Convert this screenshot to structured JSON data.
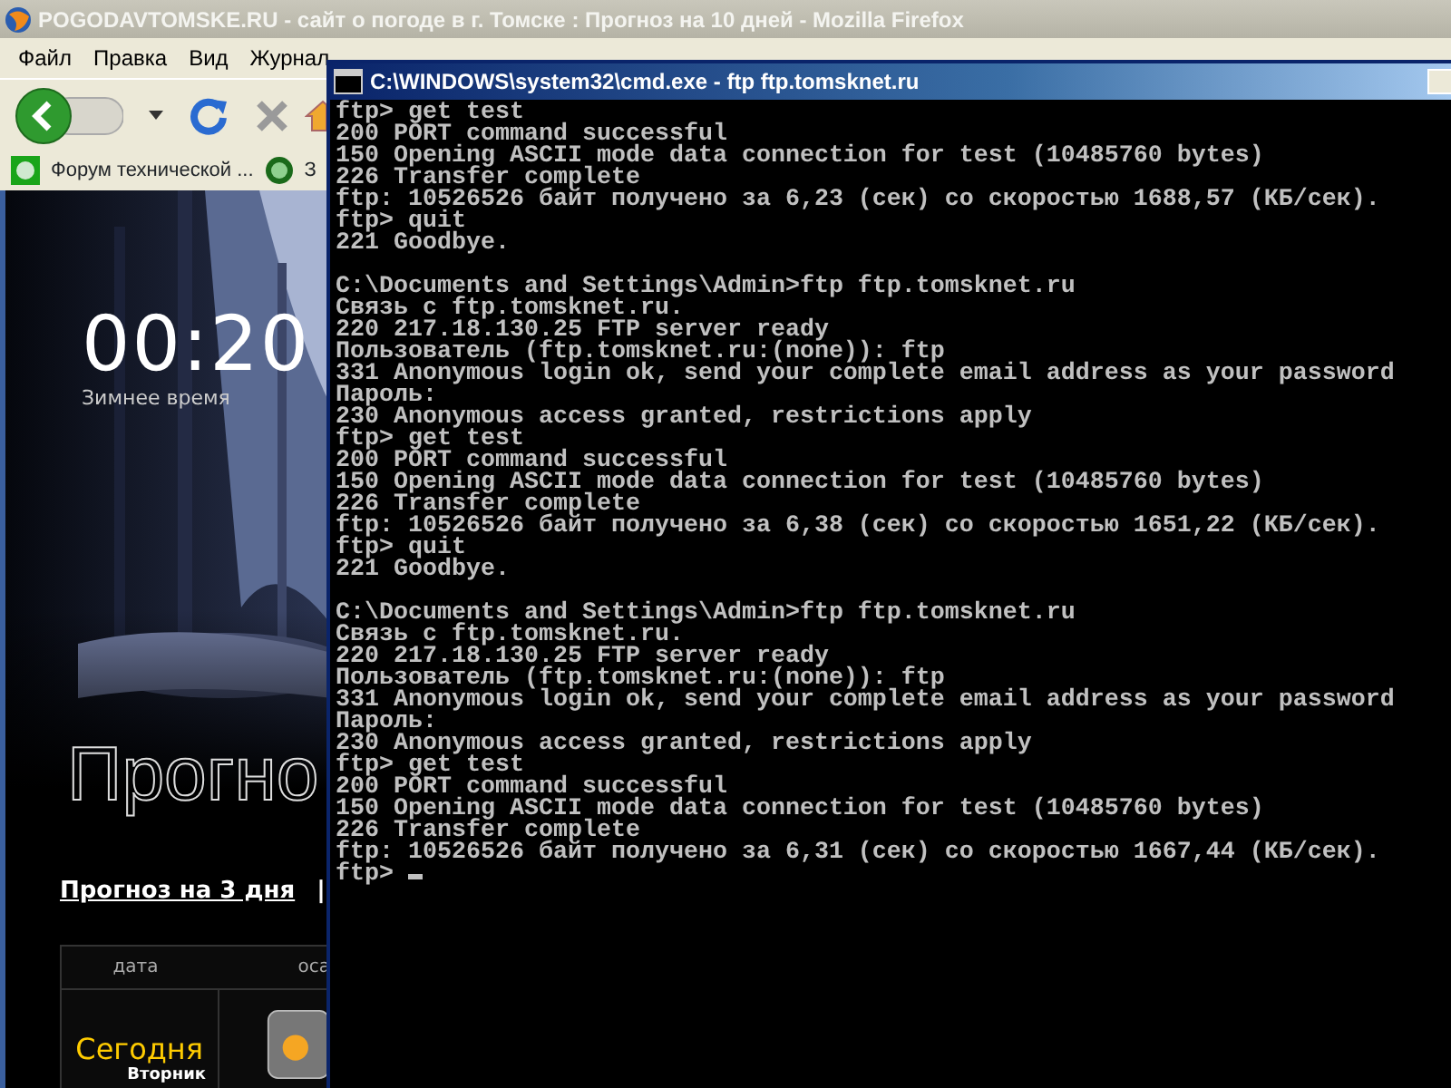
{
  "browser": {
    "title": "POGODAVTOMSKE.RU - сайт о погоде в г. Томске : Прогноз на 10 дней - Mozilla Firefox",
    "menu": [
      "Файл",
      "Правка",
      "Вид",
      "Журнал"
    ],
    "bookmarks": [
      {
        "label": "Форум технической ..."
      },
      {
        "label": "З"
      }
    ],
    "page": {
      "clock": "00:20",
      "clock_note": "Зимнее время",
      "heading": "Прогно",
      "links": [
        "Прогноз на 3 дня"
      ],
      "separator": "|",
      "table": {
        "columns": [
          "дата",
          "оса"
        ],
        "day": "Сегодня",
        "weekday": "Вторник"
      }
    }
  },
  "console": {
    "title": "C:\\WINDOWS\\system32\\cmd.exe - ftp ftp.tomsknet.ru",
    "blocks": [
      [
        "ftp> get test",
        "200 PORT command successful",
        "150 Opening ASCII mode data connection for test (10485760 bytes)",
        "226 Transfer complete",
        "ftp: 10526526 байт получено за 6,23 (сек) со скоростью 1688,57 (КБ/сек).",
        "ftp> quit",
        "221 Goodbye."
      ],
      [
        "C:\\Documents and Settings\\Admin>ftp ftp.tomsknet.ru",
        "Связь с ftp.tomsknet.ru.",
        "220 217.18.130.25 FTP server ready",
        "Пользователь (ftp.tomsknet.ru:(none)): ftp",
        "331 Anonymous login ok, send your complete email address as your password",
        "Пароль:",
        "230 Anonymous access granted, restrictions apply",
        "ftp> get test",
        "200 PORT command successful",
        "150 Opening ASCII mode data connection for test (10485760 bytes)",
        "226 Transfer complete",
        "ftp: 10526526 байт получено за 6,38 (сек) со скоростью 1651,22 (КБ/сек).",
        "ftp> quit",
        "221 Goodbye."
      ],
      [
        "C:\\Documents and Settings\\Admin>ftp ftp.tomsknet.ru",
        "Связь с ftp.tomsknet.ru.",
        "220 217.18.130.25 FTP server ready",
        "Пользователь (ftp.tomsknet.ru:(none)): ftp",
        "331 Anonymous login ok, send your complete email address as your password",
        "Пароль:",
        "230 Anonymous access granted, restrictions apply",
        "ftp> get test",
        "200 PORT command successful",
        "150 Opening ASCII mode data connection for test (10485760 bytes)",
        "226 Transfer complete",
        "ftp: 10526526 байт получено за 6,31 (сек) со скоростью 1667,44 (КБ/сек)."
      ]
    ],
    "prompt": "ftp>"
  }
}
